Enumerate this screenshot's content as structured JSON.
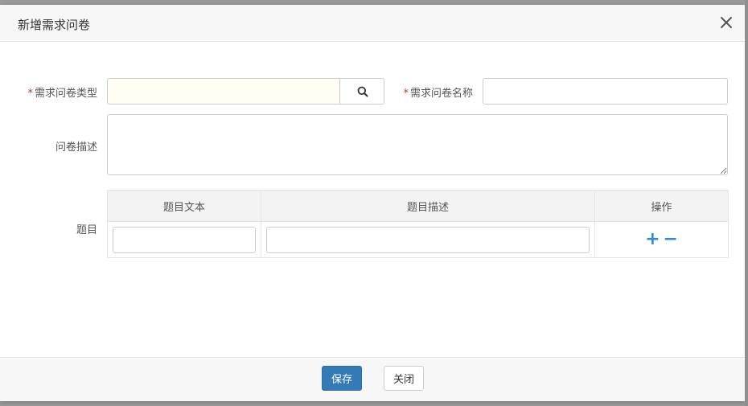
{
  "dialog": {
    "title": "新增需求问卷"
  },
  "form": {
    "required_mark": "*",
    "type_label": "需求问卷类型",
    "type_value": "",
    "name_label": "需求问卷名称",
    "name_value": "",
    "desc_label": "问卷描述",
    "desc_value": "",
    "questions_label": "题目"
  },
  "table": {
    "headers": [
      "题目文本",
      "题目描述",
      "操作"
    ],
    "rows": [
      {
        "text": "",
        "desc": "",
        "add": "+",
        "remove": "−"
      }
    ]
  },
  "footer": {
    "save_label": "保存",
    "close_label": "关闭"
  },
  "colors": {
    "primary": "#337ab7",
    "required": "#c0392b",
    "action": "#2e8bd8"
  }
}
